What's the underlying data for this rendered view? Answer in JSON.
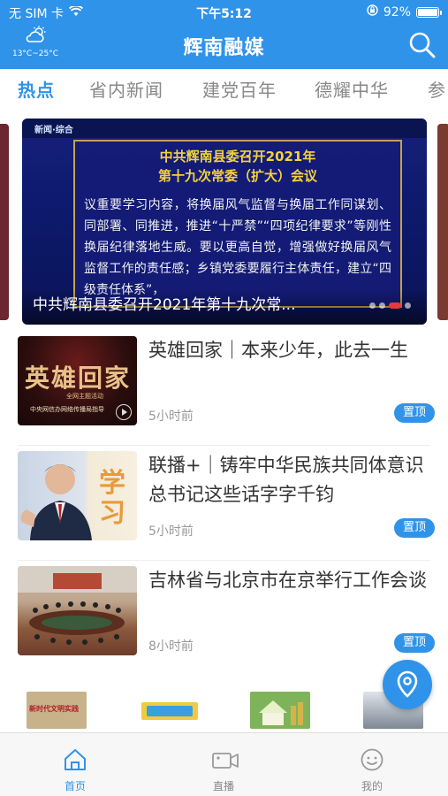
{
  "status_bar": {
    "carrier": "无 SIM 卡",
    "time": "下午5:12",
    "battery": "92%",
    "battery_level": 0.92
  },
  "header": {
    "title": "辉南融媒",
    "weather_icon": "cloudy-sun-icon",
    "temperature": "13°C~25°C",
    "search_icon": "search-icon"
  },
  "tabs": [
    {
      "label": "热点",
      "active": true
    },
    {
      "label": "省内新闻"
    },
    {
      "label": "建党百年"
    },
    {
      "label": "德耀中华"
    },
    {
      "label": "参"
    }
  ],
  "banner": {
    "logo": "新闻·综合",
    "headline_line1": "中共辉南县委召开2021年",
    "headline_line2": "第十九次常委（扩大）会议",
    "body": "议重要学习内容，将换届风气监督与换届工作同谋划、同部署、同推进，推进“十严禁”“四项纪律要求”等刚性换届纪律落地生威。要以更高自觉，增强做好换届风气监督工作的责任感；乡镇党委要履行主体责任，建立“四级责任体系”，",
    "caption": "中共辉南县委召开2021年第十九次常...",
    "dots_total": 4,
    "dot_active": 3
  },
  "news": [
    {
      "title": "英雄回家｜本来少年，此去一生",
      "time": "5小时前",
      "badge": "置顶",
      "thumb_text": "英雄回家",
      "thumb_subtitle": "中央网信办网络传播局指导",
      "thumb_sub2": "全网主题活动",
      "has_video": true
    },
    {
      "title": "联播+｜铸牢中华民族共同体意识 总书记这些话字字千钧",
      "time": "5小时前",
      "badge": "置顶",
      "thumb_text": "学习"
    },
    {
      "title": "吉林省与北京市在京举行工作会谈",
      "time": "8小时前",
      "badge": "置顶"
    }
  ],
  "services": [
    {
      "label": "新时代文明实践"
    },
    {
      "label": ""
    },
    {
      "label": ""
    },
    {
      "label": ""
    }
  ],
  "bottom_nav": [
    {
      "label": "首页",
      "icon": "home-icon",
      "active": true
    },
    {
      "label": "直播",
      "icon": "video-camera-icon"
    },
    {
      "label": "我的",
      "icon": "smiley-user-icon"
    }
  ],
  "colors": {
    "primary": "#2f93ea",
    "banner_headline": "#f5d23a",
    "active_dot": "#e8383a"
  }
}
